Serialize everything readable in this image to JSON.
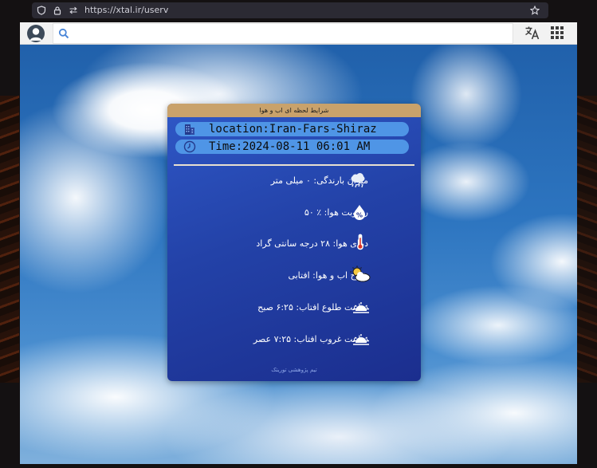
{
  "browser": {
    "url": "https://xtal.ir/userv"
  },
  "widget": {
    "header_title": "شرایط لحظه ای اب و هوا",
    "location": "location:Iran-Fars-Shiraz",
    "time": "Time:2024-08-11 06:01 AM",
    "rows": [
      {
        "text": "میزان بارندگی: ۰ میلی متر",
        "icon": "rain-cloud-icon"
      },
      {
        "text": "رطوبت هوا: ٪ ۵۰",
        "icon": "humidity-drop-icon"
      },
      {
        "text": "دمای هوا: ۲۸ درجه سانتی گراد",
        "icon": "thermometer-icon"
      },
      {
        "text": "شرح اب و هوا: افتابی",
        "icon": "sun-cloud-icon"
      },
      {
        "text": "ساعت طلوع افتاب: ۶:۲۵ صبح",
        "icon": "sunrise-icon"
      },
      {
        "text": "ساعت غروب افتاب: ۷:۲۵ عصر",
        "icon": "sunset-icon"
      }
    ],
    "footer": "تیم پژوهشی توریتک"
  },
  "colors": {
    "header_bar": "#c9a26b",
    "widget_bg": "#2342a8",
    "pill": "#4f95e6"
  }
}
